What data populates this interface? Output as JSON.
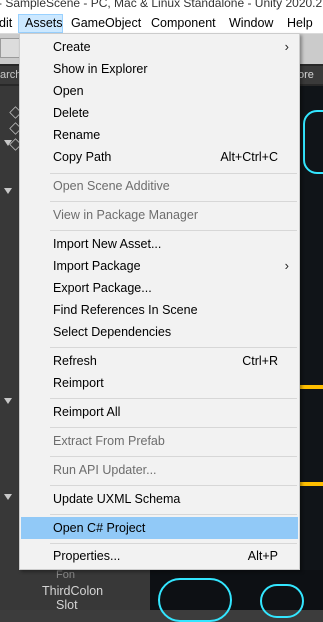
{
  "window": {
    "title": "- SampleScene - PC, Mac & Linux Standalone - Unity 2020.2."
  },
  "menubar": {
    "items": [
      "dit",
      "Assets",
      "GameObject",
      "Component",
      "Window",
      "Help"
    ],
    "active": "Assets"
  },
  "background": {
    "left_tab": "arch",
    "right_tab": "ore",
    "hierarchy_bottom": [
      "Fon",
      "ThirdColon",
      "Slot"
    ]
  },
  "assets_menu": {
    "items": [
      {
        "label": "Create",
        "submenu": true
      },
      {
        "label": "Show in Explorer"
      },
      {
        "label": "Open"
      },
      {
        "label": "Delete"
      },
      {
        "label": "Rename"
      },
      {
        "label": "Copy Path",
        "shortcut": "Alt+Ctrl+C"
      },
      {
        "label": "Open Scene Additive",
        "disabled": true
      },
      {
        "label": "View in Package Manager",
        "disabled": true
      },
      {
        "label": "Import New Asset..."
      },
      {
        "label": "Import Package",
        "submenu": true
      },
      {
        "label": "Export Package..."
      },
      {
        "label": "Find References In Scene"
      },
      {
        "label": "Select Dependencies"
      },
      {
        "label": "Refresh",
        "shortcut": "Ctrl+R"
      },
      {
        "label": "Reimport"
      },
      {
        "label": "Reimport All"
      },
      {
        "label": "Extract From Prefab",
        "disabled": true
      },
      {
        "label": "Run API Updater...",
        "disabled": true
      },
      {
        "label": "Update UXML Schema"
      },
      {
        "label": "Open C# Project",
        "highlighted": true
      },
      {
        "label": "Properties...",
        "shortcut": "Alt+P"
      }
    ]
  },
  "colors": {
    "menu_bg": "#f2f2f2",
    "highlight": "#91c9f7",
    "disabled_text": "#6d6d6d",
    "scene_accent": "#33e6ff",
    "scene_orange": "#ffbf00"
  },
  "icons": {
    "submenu": "chevron-right-icon",
    "hierarchy": "gameobject-cube-icon"
  }
}
